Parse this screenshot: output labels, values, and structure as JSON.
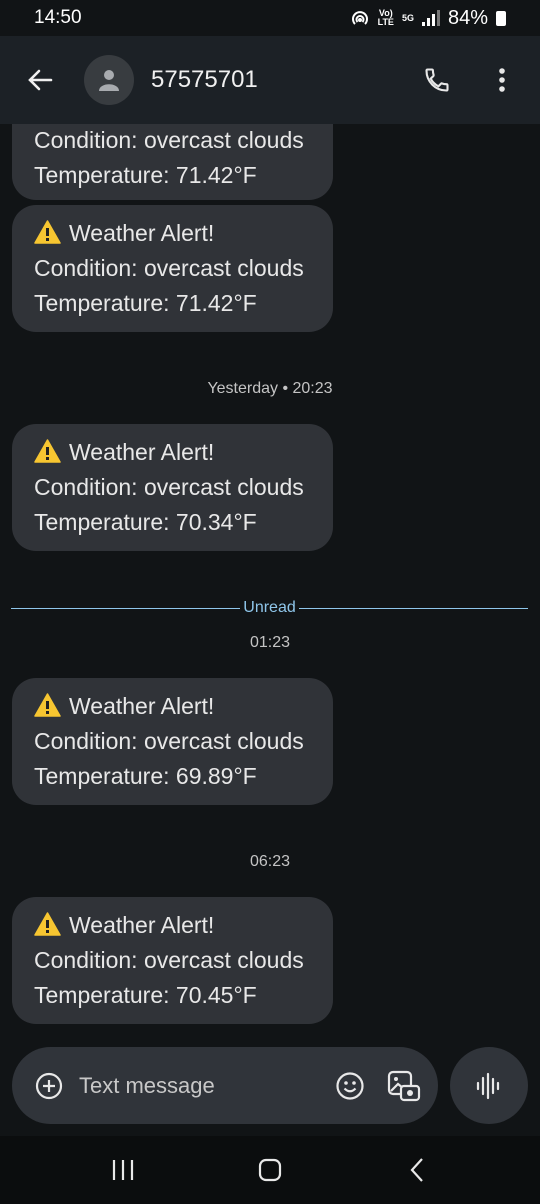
{
  "status_bar": {
    "time": "14:50",
    "battery": "84%",
    "volte": "VoLTE",
    "network": "5G"
  },
  "header": {
    "contact": "57575701"
  },
  "thread": {
    "bubbles": [
      {
        "title": "",
        "condition": "Condition: overcast clouds",
        "temperature": "Temperature: 71.42°F"
      },
      {
        "title": "Weather Alert!",
        "condition": "Condition: overcast clouds",
        "temperature": "Temperature: 71.42°F"
      },
      {
        "title": "Weather Alert!",
        "condition": "Condition: overcast clouds",
        "temperature": "Temperature: 70.34°F"
      },
      {
        "title": "Weather Alert!",
        "condition": "Condition: overcast clouds",
        "temperature": "Temperature: 69.89°F"
      },
      {
        "title": "Weather Alert!",
        "condition": "Condition: overcast clouds",
        "temperature": "Temperature: 70.45°F"
      }
    ],
    "timestamps": [
      "Yesterday • 20:23",
      "01:23",
      "06:23"
    ],
    "unread_label": "Unread"
  },
  "composer": {
    "placeholder": "Text message"
  },
  "colors": {
    "background": "#111416",
    "bubble": "#303338",
    "accent": "#8fc6ea"
  }
}
